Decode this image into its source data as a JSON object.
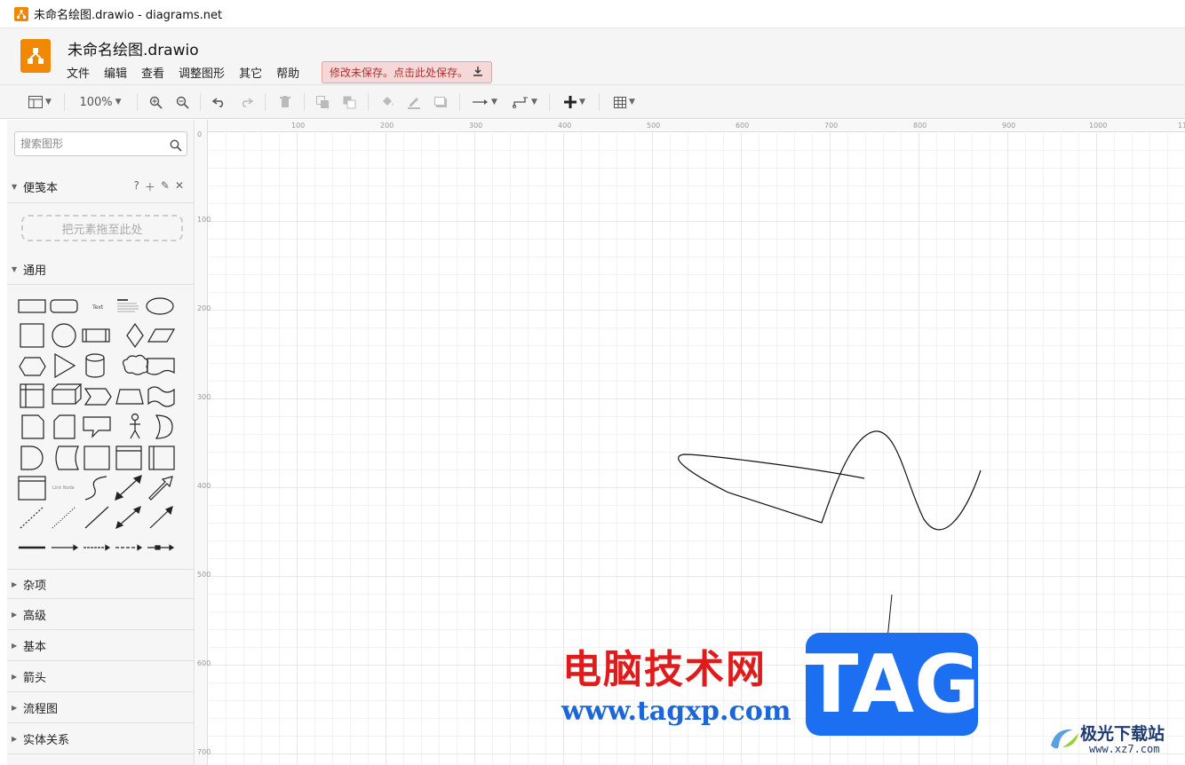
{
  "window": {
    "title": "未命名绘图.drawio - diagrams.net"
  },
  "header": {
    "doc_title": "未命名绘图.drawio",
    "menus": [
      "文件",
      "编辑",
      "查看",
      "调整图形",
      "其它",
      "帮助"
    ],
    "save_warning": "修改未保存。点击此处保存。"
  },
  "toolbar": {
    "zoom": "100%"
  },
  "sidebar": {
    "search_placeholder": "搜索图形",
    "scratchpad_label": "便笺本",
    "scratchpad_help": "?",
    "dropzone_label": "把元素拖至此处",
    "general_label": "通用",
    "collapsed_sections": [
      "杂项",
      "高级",
      "基本",
      "箭头",
      "流程图",
      "实体关系"
    ]
  },
  "ruler": {
    "top_labels": [
      "100",
      "200",
      "300",
      "400",
      "500",
      "600",
      "700",
      "800",
      "900",
      "1000",
      "11"
    ],
    "left_labels": [
      "0",
      "100",
      "200",
      "300",
      "400",
      "500",
      "600",
      "700"
    ]
  },
  "watermark": {
    "cn_text": "电脑技术网",
    "url": "www.tagxp.com",
    "tag": "TAG",
    "corner_cn": "极光下载站",
    "corner_url": "www.xz7.com"
  },
  "colors": {
    "accent": "#f08705",
    "save_warning_bg": "#f7d8d8",
    "watermark_red": "#e01b1b",
    "watermark_blue": "#1b6ff0"
  }
}
